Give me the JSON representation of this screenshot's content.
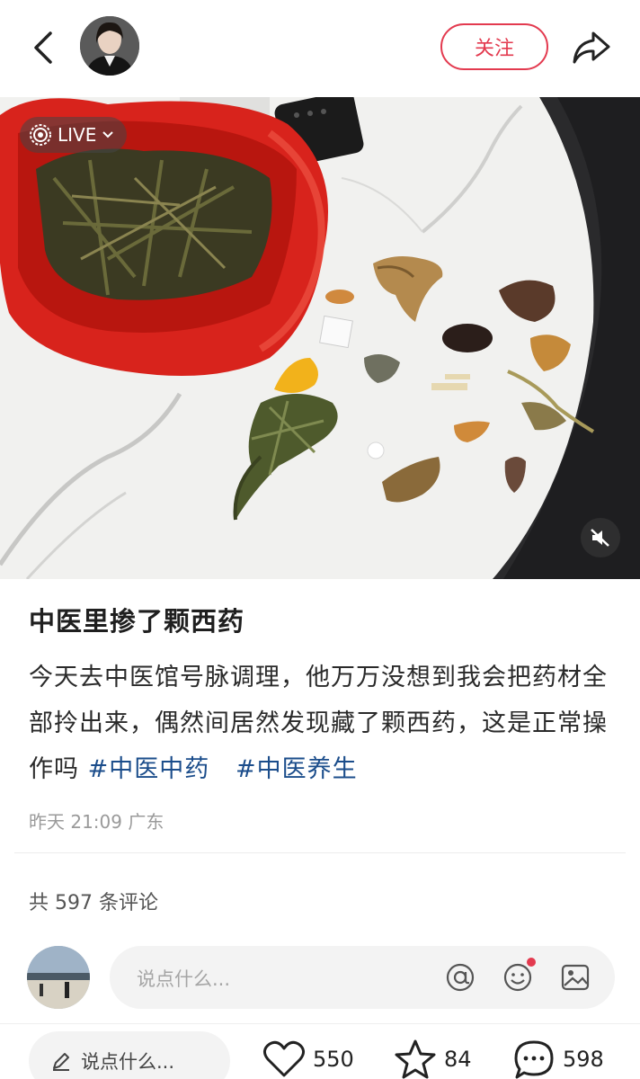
{
  "header": {
    "back_icon": "chevron-left-icon",
    "follow_label": "关注",
    "share_icon": "share-arrow-icon"
  },
  "photo": {
    "live_label": "LIVE",
    "mute_icon": "speaker-muted-icon"
  },
  "post": {
    "title": "中医里掺了颗西药",
    "body": "今天去中医馆号脉调理，他万万没想到我会把药材全部拎出来，偶然间居然发现藏了颗西药，这是正常操作吗",
    "tags": [
      "#中医中药",
      "#中医养生"
    ],
    "meta": "昨天 21:09 广东"
  },
  "comments": {
    "count_text": "共 597 条评论",
    "input_placeholder": "说点什么..."
  },
  "bottom_bar": {
    "input_placeholder": "说点什么...",
    "likes": "550",
    "favorites": "84",
    "comments": "598"
  },
  "colors": {
    "accent": "#e33a4f",
    "tag": "#1b4d8b"
  }
}
